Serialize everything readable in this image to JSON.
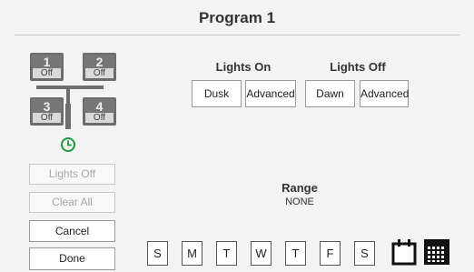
{
  "header": {
    "title": "Program 1"
  },
  "switches": [
    {
      "number": "1",
      "state": "Off"
    },
    {
      "number": "2",
      "state": "Off"
    },
    {
      "number": "3",
      "state": "Off"
    },
    {
      "number": "4",
      "state": "Off"
    }
  ],
  "left_actions": {
    "lights_off": "Lights Off",
    "clear_all": "Clear All",
    "cancel": "Cancel",
    "done": "Done"
  },
  "lights_on": {
    "label": "Lights On",
    "option1": "Dusk",
    "option2": "Advanced"
  },
  "lights_off": {
    "label": "Lights Off",
    "option1": "Dawn",
    "option2": "Advanced"
  },
  "range": {
    "label": "Range",
    "value": "NONE"
  },
  "days": [
    "S",
    "M",
    "T",
    "W",
    "T",
    "F",
    "S"
  ],
  "icons": {
    "timer": "clock-icon",
    "single_date": "calendar-icon",
    "month": "calendar-grid-icon"
  },
  "colors": {
    "accent_green": "#1e9a3c",
    "switch_gray": "#6f6f6f"
  }
}
